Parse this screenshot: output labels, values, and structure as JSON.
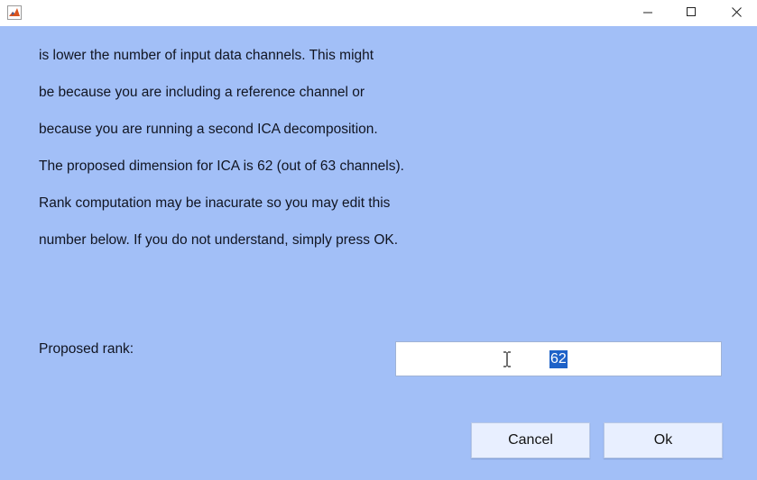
{
  "window": {
    "controls": [
      "minimize",
      "maximize",
      "close"
    ]
  },
  "message": {
    "lines": [
      "is lower the number of input data channels. This might",
      "be because you are including a reference channel or",
      "because you are running a second ICA decomposition.",
      "The proposed dimension for ICA is 62 (out of 63 channels).",
      "Rank computation may be inacurate so you may edit this",
      "number below. If you do not understand, simply press OK."
    ]
  },
  "rank": {
    "label": "Proposed rank:",
    "value": "62"
  },
  "buttons": {
    "cancel": "Cancel",
    "ok": "Ok"
  },
  "colors": {
    "background": "#a2bff7",
    "selection": "#1e62c8"
  },
  "icons": {
    "app": "matlab-icon",
    "minimize": "minimize-icon",
    "maximize": "maximize-icon",
    "close": "close-icon",
    "cursor": "text-cursor-icon"
  }
}
